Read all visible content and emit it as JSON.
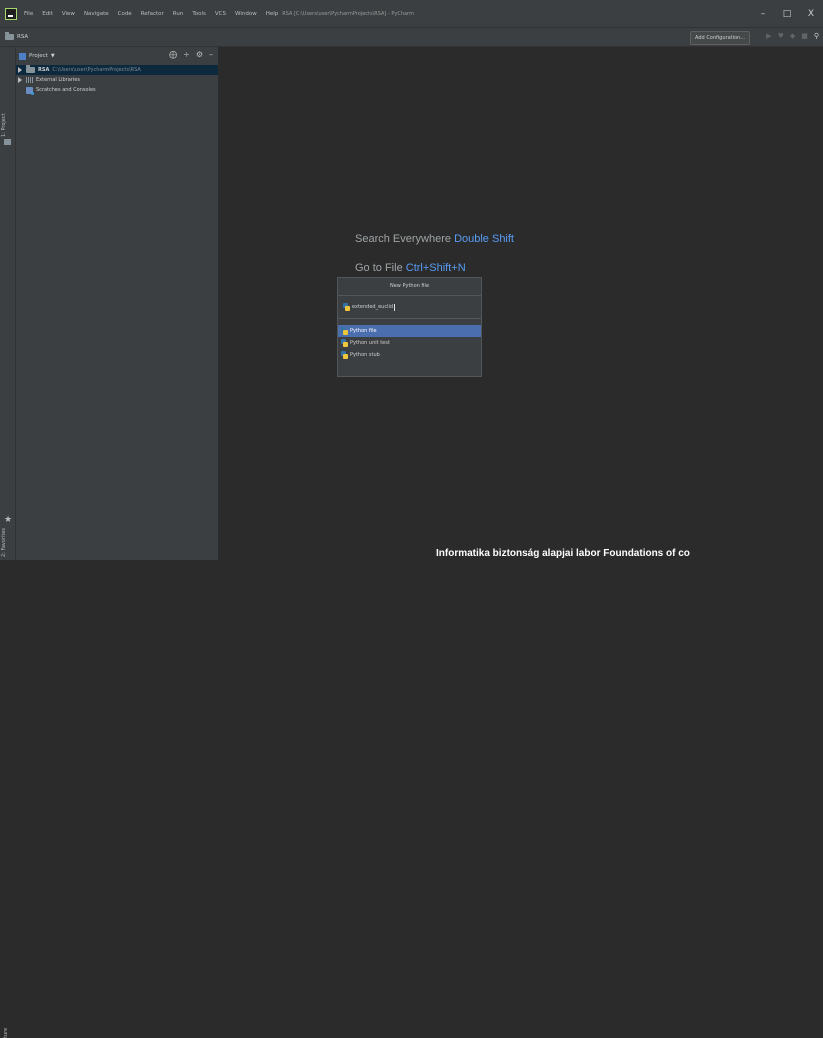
{
  "titlebar": {
    "menu": [
      "File",
      "Edit",
      "View",
      "Navigate",
      "Code",
      "Refactor",
      "Run",
      "Tools",
      "VCS",
      "Window",
      "Help"
    ],
    "title": "RSA [C:\\Users\\user\\PycharmProjects\\RSA] - PyCharm",
    "controls": [
      "–",
      "□",
      "X"
    ]
  },
  "navbar": {
    "crumb": "RSA",
    "add_configuration": "Add Configuration...",
    "icons": [
      "run-icon",
      "debug-icon",
      "coverage-icon",
      "stop-icon",
      "search-icon"
    ]
  },
  "left_strip": {
    "project_tab": "1: Project",
    "favorites_tab": "2: Favorites",
    "structure_tab": "ture"
  },
  "project_panel": {
    "title": "Project",
    "tree": {
      "root_name": "RSA",
      "root_path": "C:\\Users\\user\\PycharmProjects\\RSA",
      "external": "External Libraries",
      "scratches": "Scratches and Consoles"
    }
  },
  "editor": {
    "hint1_text": "Search Everywhere",
    "hint1_key": "Double Shift",
    "hint2_text": "Go to File",
    "hint2_key": "Ctrl+Shift+N"
  },
  "new_file_popup": {
    "title": "New Python file",
    "input_value": "extended_euclid",
    "options": [
      "Python file",
      "Python unit test",
      "Python stub"
    ],
    "selected_index": 0
  },
  "footer_overlay": "Informatika biztonság alapjai labor Foundations of co"
}
